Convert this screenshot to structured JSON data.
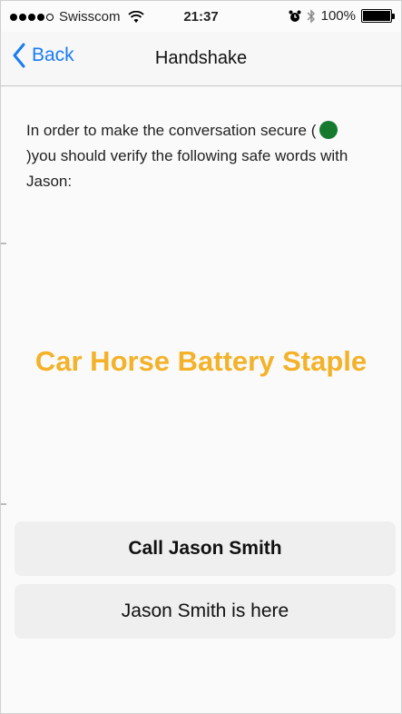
{
  "status_bar": {
    "carrier": "Swisscom",
    "signal_bars": 4,
    "signal_total": 5,
    "time": "21:37",
    "battery": "100%",
    "icons": [
      "wifi-icon",
      "alarm-icon",
      "bluetooth-icon",
      "battery-icon"
    ]
  },
  "nav": {
    "back_label": "Back",
    "title": "Handshake"
  },
  "content": {
    "instruction_part1": "In order to make the conversation secure (",
    "instruction_part2": ")you should verify the following safe words with Jason:",
    "secure_indicator_color": "#157a2e",
    "safe_words": "Car Horse Battery Staple",
    "safe_words_color": "#f3b229"
  },
  "actions": {
    "call_label": "Call Jason Smith",
    "here_label": "Jason Smith is here"
  },
  "colors": {
    "accent": "#1a7cf5"
  }
}
